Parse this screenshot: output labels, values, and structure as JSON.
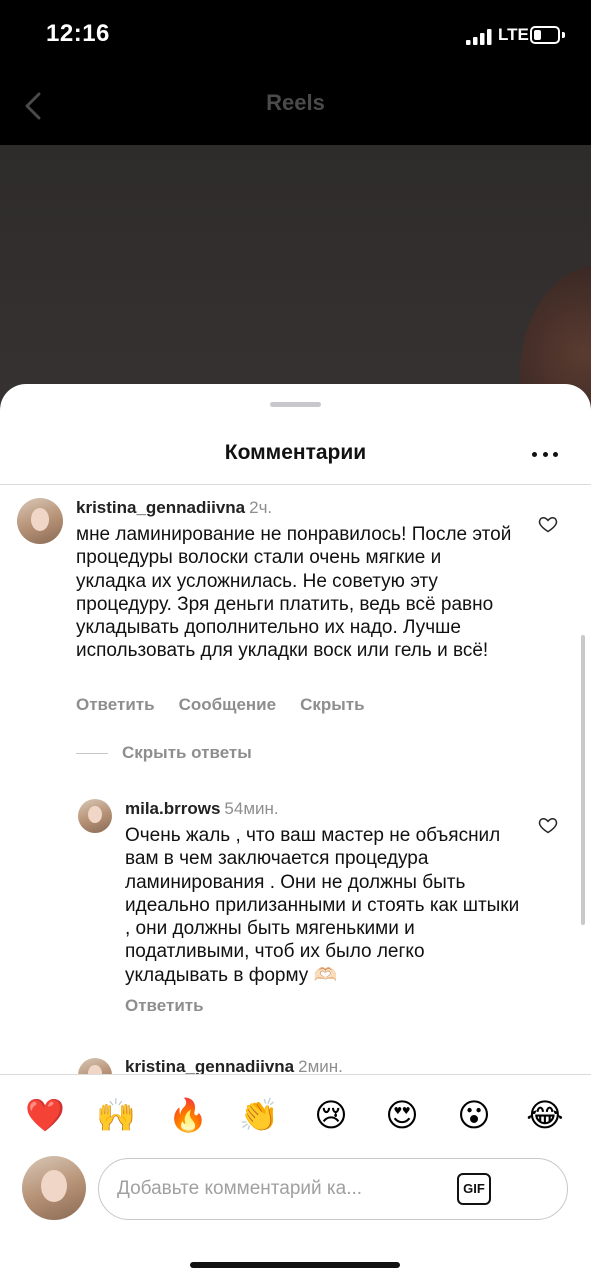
{
  "status_bar": {
    "time": "12:16",
    "network": "LTE",
    "battery_level": 0.3
  },
  "header": {
    "title": "Reels",
    "back_icon": "chevron-left-icon"
  },
  "sheet": {
    "title": "Комментарии",
    "more_icon": "more-horizontal-icon"
  },
  "comments": [
    {
      "username": "kristina_gennadiivna",
      "time": "2ч.",
      "text": "мне ламинирование не понравилось! После этой процедуры волоски стали очень мягкие и укладка их усложнилась. Не советую эту процедуру. Зря деньги платить, ведь всё равно укладывать дополнительно их надо. Лучше использовать для укладки воск или гель и всё!",
      "actions": [
        "Ответить",
        "Сообщение",
        "Скрыть"
      ]
    }
  ],
  "hide_replies_label": "Скрыть ответы",
  "replies": [
    {
      "username": "mila.brrows",
      "time": "54мин.",
      "text": "Очень жаль , что ваш мастер не объяснил вам в чем заключается процедура ламинирования . Они не должны быть идеально прилизанными и стоять как штыки , они должны быть мягенькими и податливыми, чтоб их было легко укладывать в форму 🫶🏻",
      "reply_label": "Ответить"
    },
    {
      "username": "kristina_gennadiivna",
      "time": "2мин."
    }
  ],
  "emoji_reactions": [
    "❤️",
    "🙌",
    "🔥",
    "👏",
    "😢",
    "😍",
    "😮",
    "😂"
  ],
  "input": {
    "placeholder": "Добавьте комментарий ка...",
    "gif_label": "GIF"
  },
  "colors": {
    "heart": "#ed4956",
    "muted_text": "#8e8e8e"
  }
}
